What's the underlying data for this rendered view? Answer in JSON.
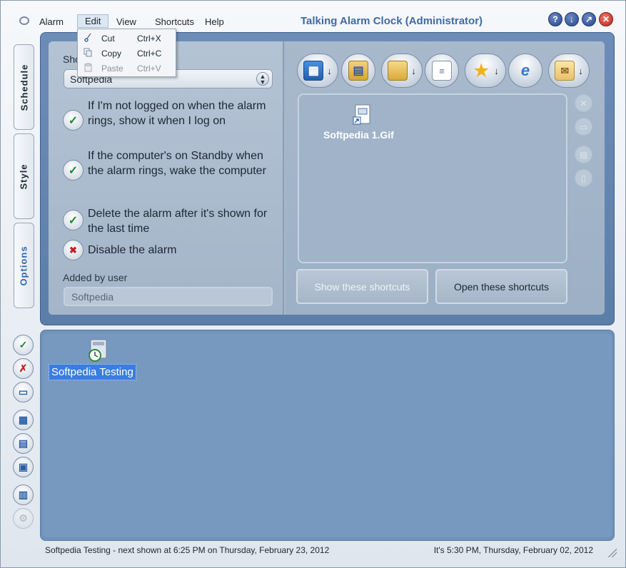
{
  "window": {
    "title": "Talking Alarm Clock (Administrator)"
  },
  "menubar": {
    "items": [
      {
        "label": "Alarm"
      },
      {
        "label": "Edit"
      },
      {
        "label": "View"
      },
      {
        "label": "Shortcuts"
      },
      {
        "label": "Help"
      }
    ]
  },
  "title_buttons": [
    "help-icon",
    "minimize-icon",
    "restore-icon",
    "close-icon"
  ],
  "edit_menu": {
    "items": [
      {
        "label": "Cut",
        "shortcut": "Ctrl+X",
        "icon": "cut-icon",
        "enabled": true
      },
      {
        "label": "Copy",
        "shortcut": "Ctrl+C",
        "icon": "copy-icon",
        "enabled": true
      },
      {
        "label": "Paste",
        "shortcut": "Ctrl+V",
        "icon": "paste-icon",
        "enabled": false
      }
    ]
  },
  "side_tabs": [
    {
      "label": "Schedule",
      "active": false
    },
    {
      "label": "Style",
      "active": false
    },
    {
      "label": "Options",
      "active": true
    }
  ],
  "options": {
    "show_label": "Sho",
    "show_value": "Softpedia",
    "checks": [
      {
        "text": "If I'm not logged on when the alarm rings, show it when I log on",
        "checked": true
      },
      {
        "text": "If the computer's on Standby when the alarm rings, wake the computer",
        "checked": true
      },
      {
        "text": "Delete the alarm after it's shown for the last time",
        "checked": true
      },
      {
        "text": "Disable the alarm",
        "checked": false
      }
    ],
    "added_by_label": "Added by user",
    "added_by_value": "Softpedia"
  },
  "shortcuts": {
    "toolbar": [
      "add-program-icon",
      "open-folder-icon",
      "folder-icon",
      "document-icon",
      "favorites-star-icon",
      "internet-explorer-icon",
      "email-icon"
    ],
    "files": [
      {
        "label": "Softpedia 1.Gif",
        "icon": "shortcut-file-icon"
      }
    ],
    "side_icons": [
      "delete-icon",
      "properties-icon",
      "rename-icon",
      "copy-icon"
    ],
    "show_button": "Show these shortcuts",
    "open_button": "Open these shortcuts"
  },
  "alarms": {
    "items": [
      {
        "label": "Softpedia Testing",
        "selected": true,
        "icon": "alarm-clock-icon"
      }
    ]
  },
  "left_buttons": [
    "ok-check-icon",
    "cancel-alarm-icon",
    "display-icon",
    "calendar-grid-icon",
    "calendar-list-icon",
    "calendar-day-icon",
    "calendar-window-icon",
    "settings-disabled-icon"
  ],
  "status": {
    "left": "Softpedia Testing - next shown at 6:25 PM on Thursday, February 23, 2012",
    "right": "It's 5:30 PM, Thursday, February 02, 2012"
  },
  "colors": {
    "accent": "#3f6aa6",
    "frame": "#5b7ea9",
    "selection": "#3b7de0"
  }
}
